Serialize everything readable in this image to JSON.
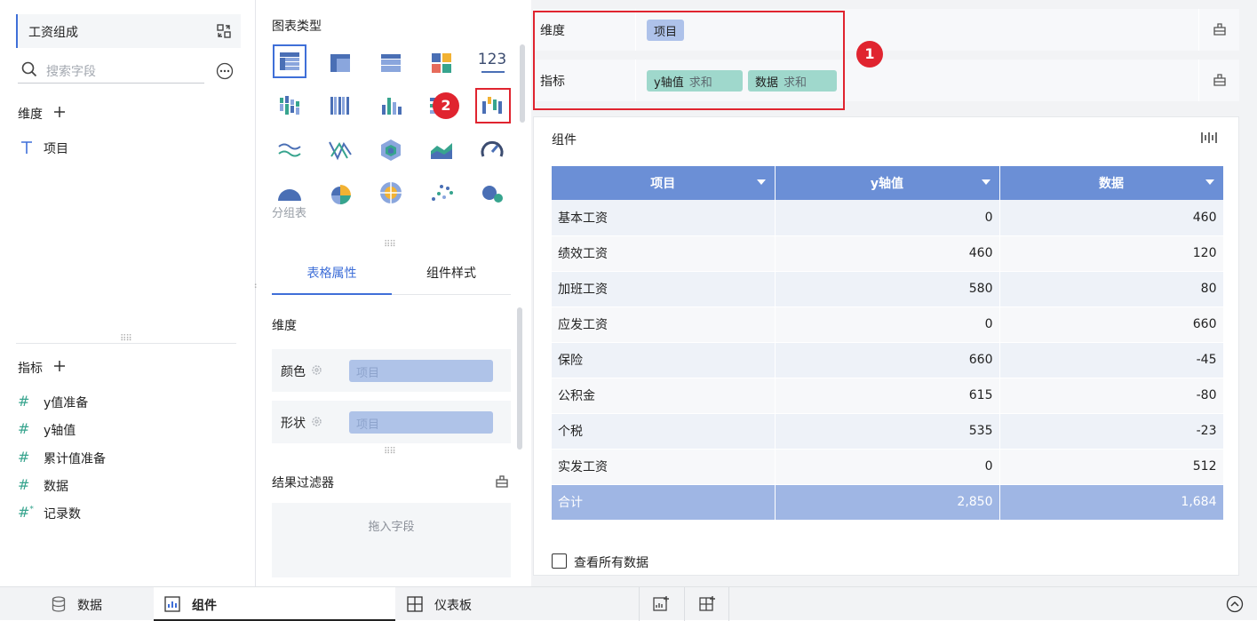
{
  "left": {
    "component_title": "工资组成",
    "search_placeholder": "搜索字段",
    "dimension_title": "维度",
    "dimension_fields": [
      "项目"
    ],
    "indicator_title": "指标",
    "indicator_fields": [
      "y值准备",
      "y轴值",
      "累计值准备",
      "数据",
      "记录数"
    ]
  },
  "middle": {
    "chart_type_title": "图表类型",
    "number_icon_label": "123",
    "group_table_label": "分组表",
    "tabs": [
      "表格属性",
      "组件样式"
    ],
    "prop_section_title": "维度",
    "props": [
      {
        "label": "颜色",
        "value": "项目"
      },
      {
        "label": "形状",
        "value": "项目"
      }
    ],
    "filter_title": "结果过滤器",
    "filter_drop_hint": "拖入字段"
  },
  "right": {
    "dimension_shelf_label": "维度",
    "dimension_chip": "项目",
    "indicator_shelf_label": "指标",
    "indicator_chips": [
      {
        "name": "y轴值",
        "agg": "求和"
      },
      {
        "name": "数据",
        "agg": "求和"
      }
    ],
    "badge1": "1",
    "badge2": "2",
    "card_title": "组件",
    "table": {
      "headers": [
        "项目",
        "y轴值",
        "数据"
      ],
      "rows": [
        [
          "基本工资",
          "0",
          "460"
        ],
        [
          "绩效工资",
          "460",
          "120"
        ],
        [
          "加班工资",
          "580",
          "80"
        ],
        [
          "应发工资",
          "0",
          "660"
        ],
        [
          "保险",
          "660",
          "-45"
        ],
        [
          "公积金",
          "615",
          "-80"
        ],
        [
          "个税",
          "535",
          "-23"
        ],
        [
          "实发工资",
          "0",
          "512"
        ]
      ],
      "total": [
        "合计",
        "2,850",
        "1,684"
      ]
    },
    "view_all_label": "查看所有数据"
  },
  "bottom": {
    "tabs": [
      "数据",
      "组件",
      "仪表板"
    ]
  },
  "colors": {
    "accent": "#3f6fd8",
    "header_blue": "#6b8fd6",
    "total_blue": "#9fb6e4",
    "highlight_red": "#e0242f",
    "indicator_teal": "#9fd8cc",
    "dimension_blue": "#aec2ea"
  }
}
